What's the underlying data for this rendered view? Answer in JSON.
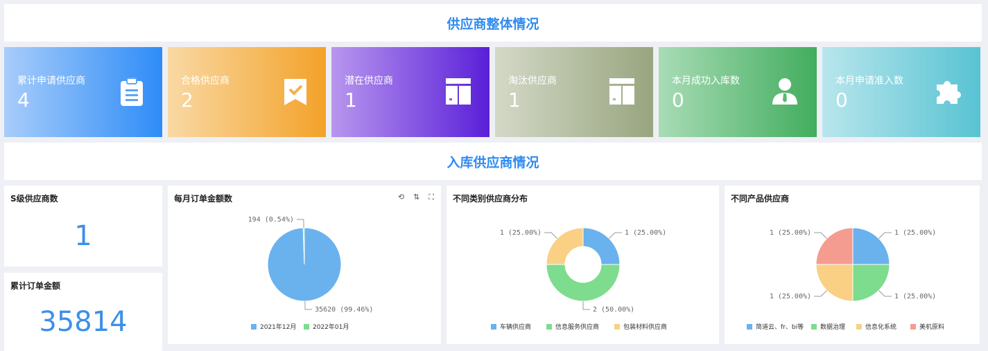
{
  "header": {
    "title": "供应商整体情况"
  },
  "section2": {
    "title": "入库供应商情况"
  },
  "cards": [
    {
      "label": "累计申请供应商",
      "value": "4",
      "icon": "clipboard-icon"
    },
    {
      "label": "合格供应商",
      "value": "2",
      "icon": "bookmark-check-icon"
    },
    {
      "label": "潜在供应商",
      "value": "1",
      "icon": "cabinet-icon"
    },
    {
      "label": "淘汰供应商",
      "value": "1",
      "icon": "cabinet-icon"
    },
    {
      "label": "本月成功入库数",
      "value": "0",
      "icon": "user-tie-icon"
    },
    {
      "label": "本月申请准入数",
      "value": "0",
      "icon": "puzzle-icon"
    }
  ],
  "s_level": {
    "title": "S级供应商数",
    "value": "1"
  },
  "total_amount": {
    "title": "累计订单金额",
    "value": "35814"
  },
  "toolbar": {
    "refresh": "⟲",
    "sort": "⇅",
    "fullscreen": "⛶"
  },
  "chart_data": [
    {
      "type": "pie",
      "title": "每月订单金额数",
      "categories": [
        "2021年12月",
        "2022年01月"
      ],
      "values": [
        35620,
        194
      ],
      "labels": [
        "35620 (99.46%)",
        "194 (0.54%)"
      ],
      "colors": [
        "#6ab2ee",
        "#7ddc8e"
      ]
    },
    {
      "type": "pie",
      "variant": "donut",
      "title": "不同类别供应商分布",
      "categories": [
        "车辆供应商",
        "信息服务供应商",
        "包装材料供应商"
      ],
      "values": [
        1,
        2,
        1
      ],
      "labels": [
        "1 (25.00%)",
        "2 (50.00%)",
        "1 (25.00%)"
      ],
      "colors": [
        "#6ab2ee",
        "#7ddc8e",
        "#f9d084"
      ]
    },
    {
      "type": "pie",
      "title": "不同产品供应商",
      "categories": [
        "简道云、fr、bi等",
        "数据治理",
        "信息化系统",
        "美机原料"
      ],
      "values": [
        1,
        1,
        1,
        1
      ],
      "labels": [
        "1 (25.00%)",
        "1 (25.00%)",
        "1 (25.00%)",
        "1 (25.00%)"
      ],
      "colors": [
        "#6ab2ee",
        "#7ddc8e",
        "#f9d084",
        "#f59c90"
      ]
    }
  ]
}
